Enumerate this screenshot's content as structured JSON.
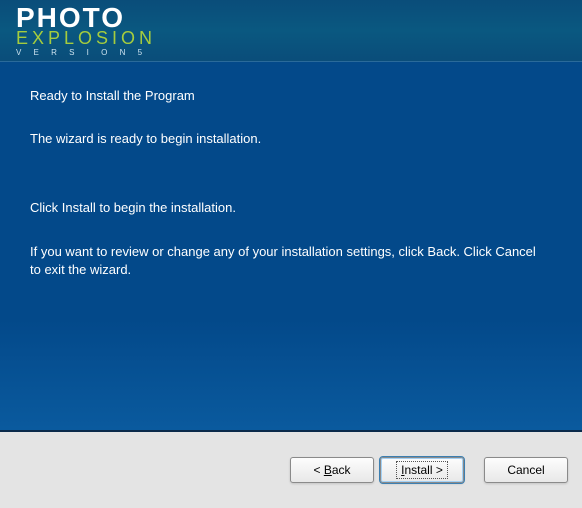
{
  "logo": {
    "line1": "PHOTO",
    "line2": "EXPLOSION",
    "line3": "V E R S I O N  5"
  },
  "content": {
    "heading": "Ready to Install the Program",
    "wizard_ready": "The wizard is ready to begin installation.",
    "click_install": "Click Install to begin the installation.",
    "review_text": "If you want to review or change any of your installation settings, click Back. Click Cancel to exit the wizard."
  },
  "buttons": {
    "back_prefix": "< ",
    "back_mn": "B",
    "back_rest": "ack",
    "install_mn": "I",
    "install_rest": "nstall >",
    "cancel": "Cancel"
  }
}
